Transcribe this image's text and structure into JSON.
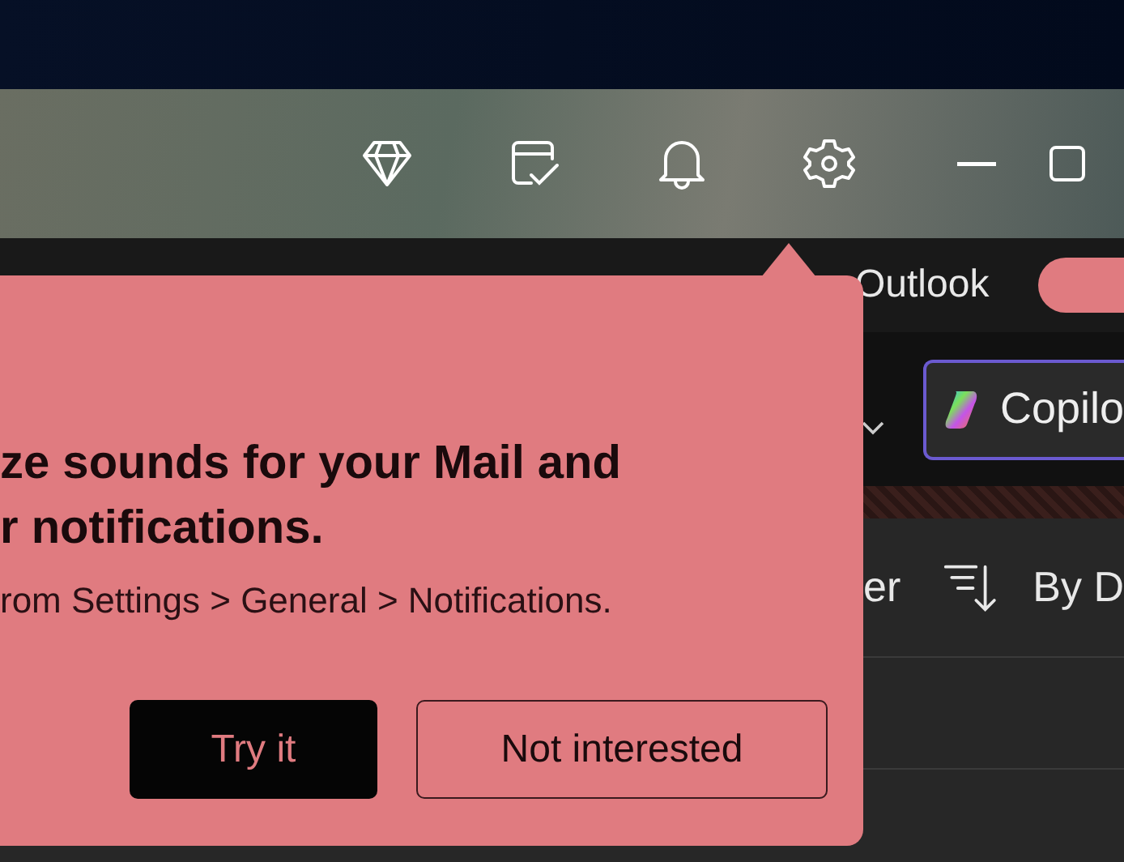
{
  "header": {
    "app_name": "Outlook",
    "toggle_on": true
  },
  "toolbar": {
    "copilot_button": "Copilo"
  },
  "message_list": {
    "filter_label": "er",
    "sort_label": "By D"
  },
  "popup": {
    "title": "ze sounds for your Mail and\nr notifications.",
    "body": "rom Settings > General > Notifications.",
    "buttons": [
      {
        "label": "Try it",
        "kind": "primary"
      },
      {
        "label": "Not interested",
        "kind": "secondary"
      }
    ]
  }
}
